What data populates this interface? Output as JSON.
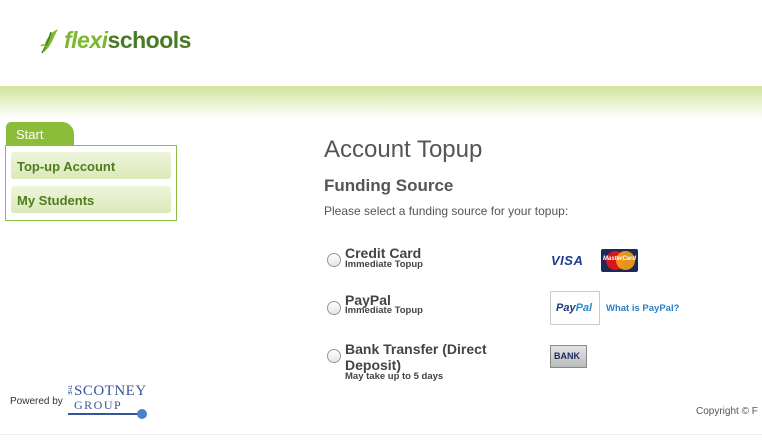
{
  "header": {
    "logo": {
      "part1": "flexi",
      "part2": "schools",
      "icon": "leaf-icon"
    }
  },
  "sidebar": {
    "tab_label": "Start",
    "items": [
      {
        "label": "Top-up Account"
      },
      {
        "label": "My Students"
      }
    ]
  },
  "main": {
    "title": "Account Topup",
    "subtitle": "Funding Source",
    "instruction": "Please select a funding source for your topup:",
    "options": [
      {
        "label": "Credit Card",
        "sub": "Immediate Topup",
        "logos": [
          "VISA",
          "MasterCard"
        ]
      },
      {
        "label": "PayPal",
        "sub": "Immediate Topup",
        "logo_dark": "Pay",
        "logo_light": "Pal",
        "link": "What is PayPal?"
      },
      {
        "label_line1": "Bank Transfer (Direct",
        "label_line2": "Deposit)",
        "sub": "May take up to 5 days",
        "logo": "BANK"
      }
    ]
  },
  "footer": {
    "powered_by": "Powered by",
    "scotney": {
      "the": "THE",
      "line1": "SCOTNEY",
      "line2": "GROUP"
    },
    "copyright": "Copyright © F"
  },
  "colors": {
    "brand_green": "#7cb82f",
    "brand_dark_green": "#4a7a23",
    "nav_border": "#8cbf41",
    "link_blue": "#2b7fc6"
  }
}
